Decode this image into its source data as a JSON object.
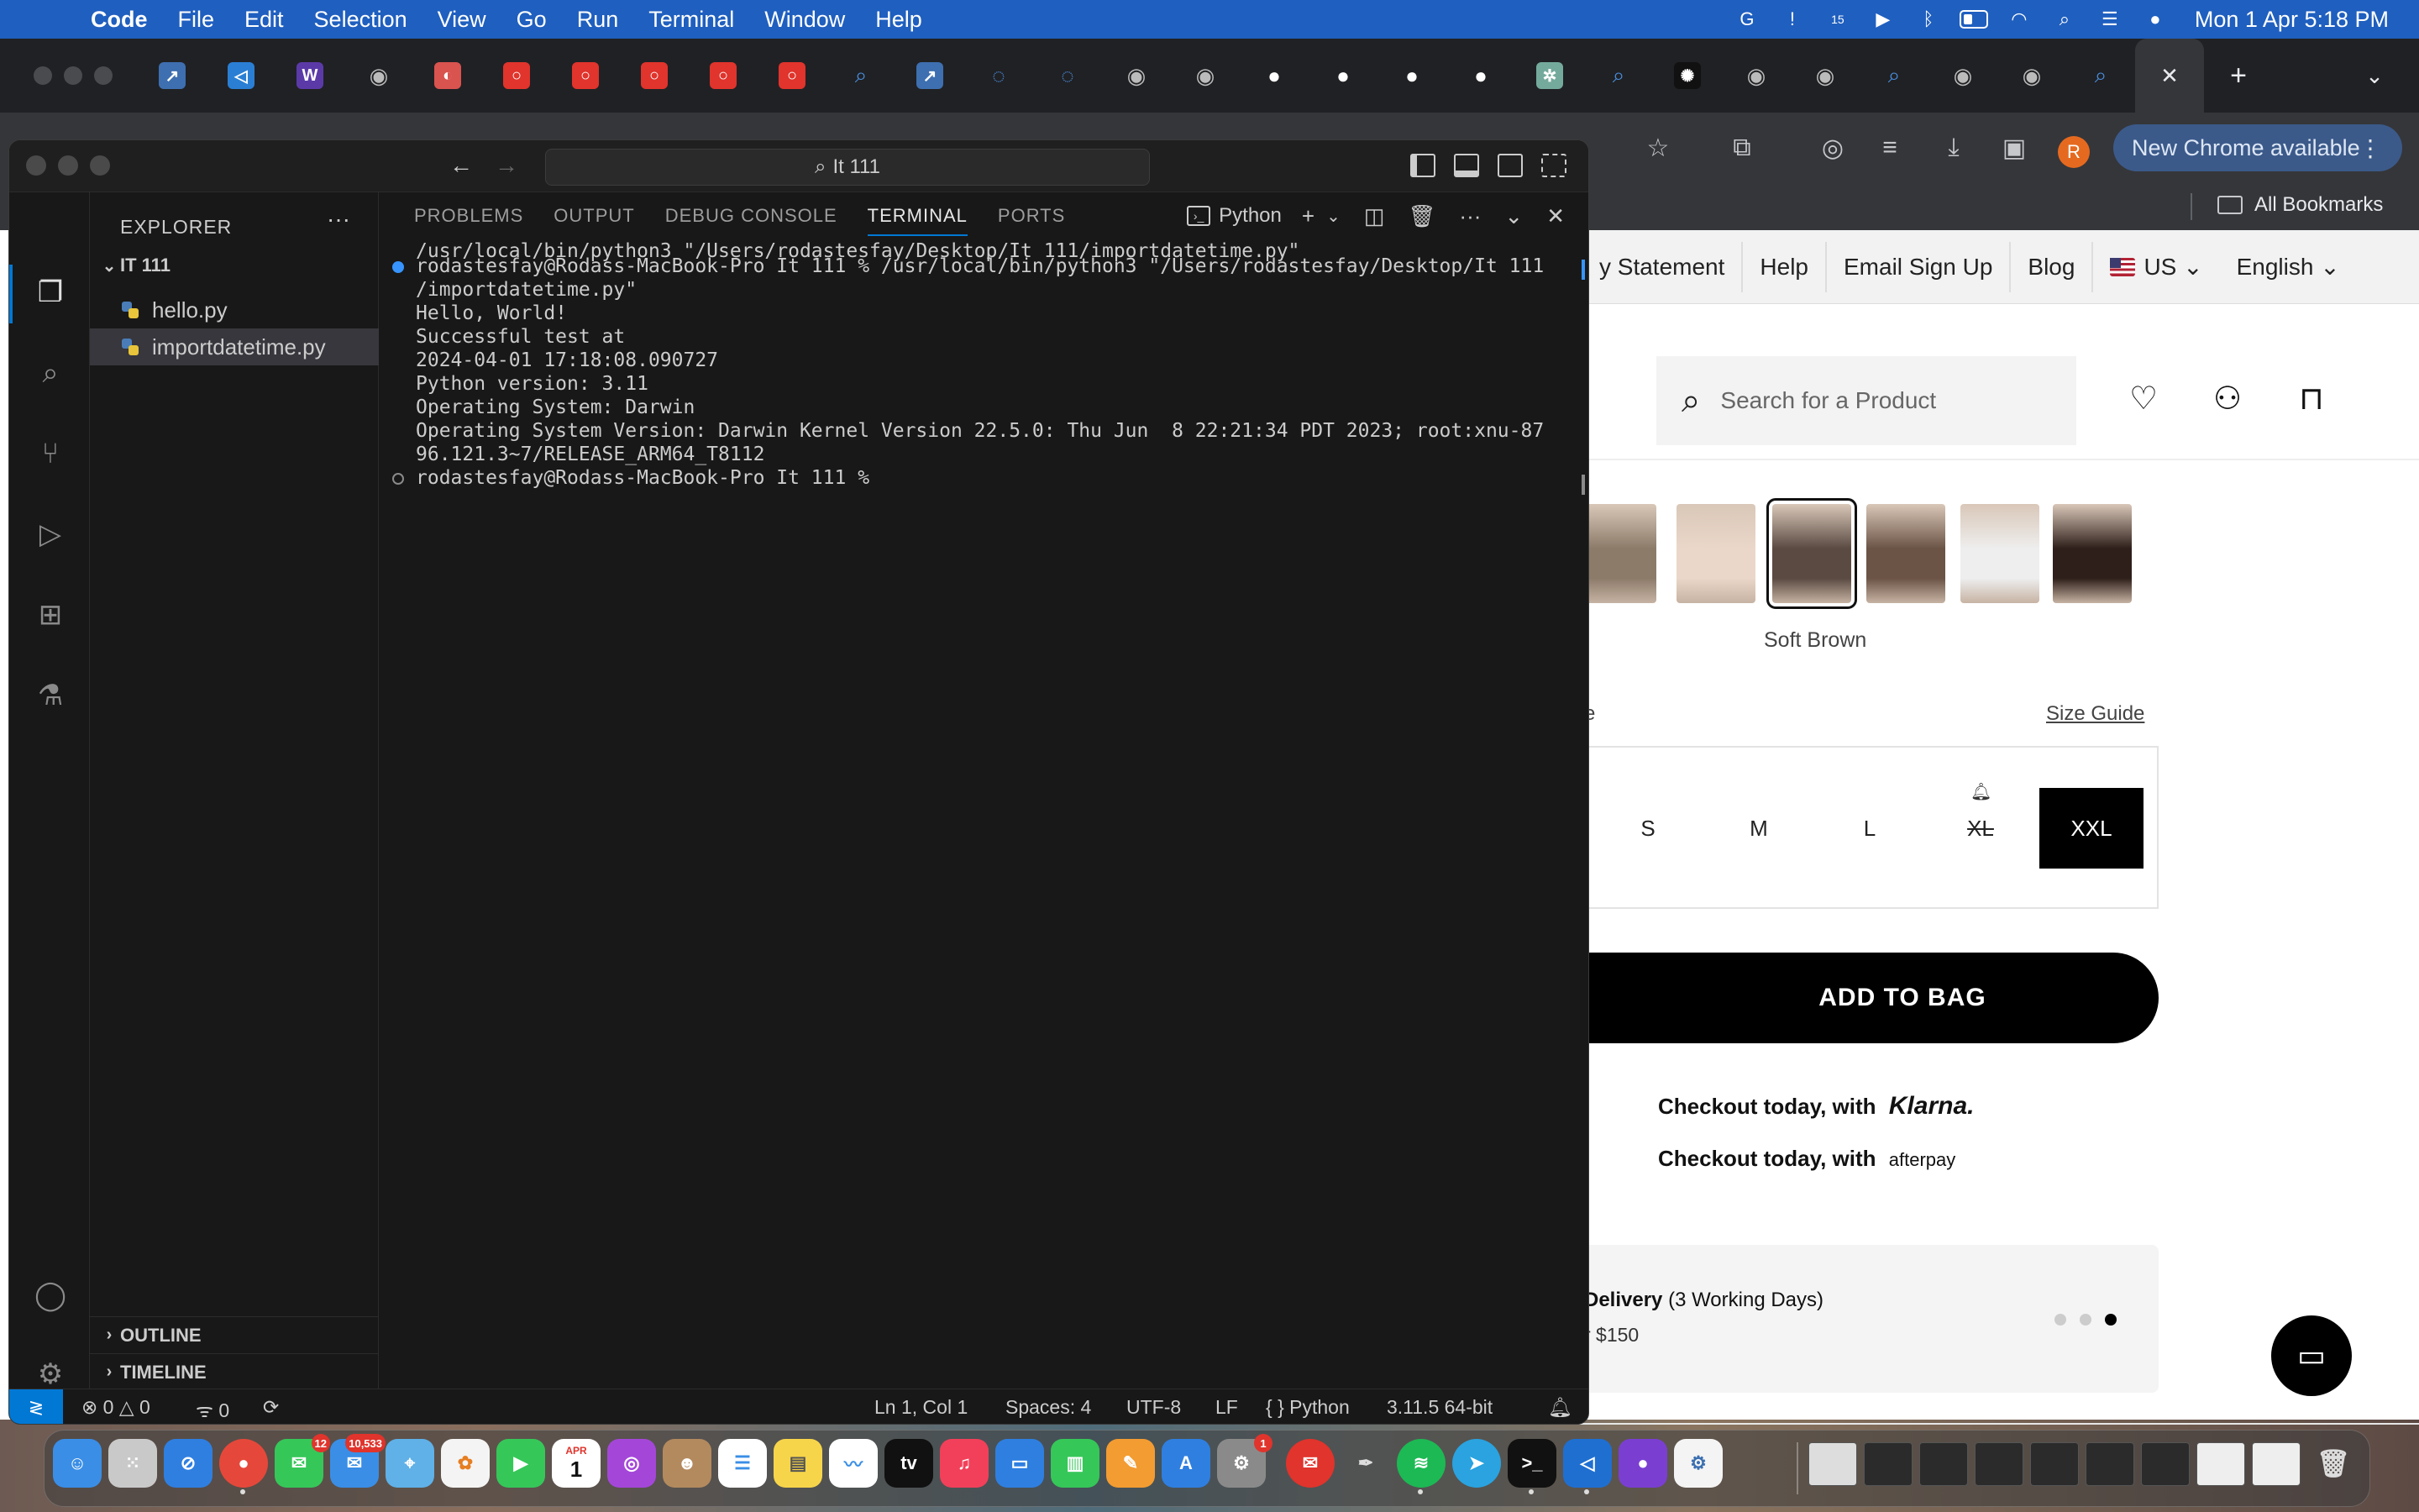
{
  "menubar": {
    "app_name": "Code",
    "items": [
      "File",
      "Edit",
      "Selection",
      "View",
      "Go",
      "Run",
      "Terminal",
      "Window",
      "Help"
    ],
    "clock": "Mon 1 Apr  5:18 PM",
    "notification_badge": "15"
  },
  "chrome": {
    "new_chrome_label": "New Chrome available",
    "bookmarks_label": "All Bookmarks",
    "avatar_initial": "R"
  },
  "site": {
    "nav_links": [
      "y Statement",
      "Help",
      "Email Sign Up",
      "Blog"
    ],
    "country": "US",
    "language": "English",
    "search_placeholder": "Search for a Product",
    "color_label": "Soft Brown",
    "size_label_fragment": "e",
    "size_guide": "Size Guide",
    "sizes": [
      "S",
      "M",
      "L",
      "XL",
      "XXL"
    ],
    "add_to_bag": "ADD TO BAG",
    "checkout_klarna_prefix": "Checkout today, with",
    "checkout_klarna_brand": "Klarna.",
    "checkout_afterpay_prefix": "Checkout today, with",
    "checkout_afterpay_brand": "afterpay",
    "delivery_title": "Delivery",
    "delivery_days": "(3 Working Days)",
    "delivery_sub": "r $150",
    "swatch_colors": [
      "#8d7b6a",
      "#ead7c9",
      "#5a4a42",
      "#6b5446",
      "#eeeeee",
      "#2e1f1a"
    ]
  },
  "vscode": {
    "search": "It 111",
    "explorer_title": "EXPLORER",
    "folder": "IT 111",
    "files": [
      "hello.py",
      "importdatetime.py"
    ],
    "sections": [
      "OUTLINE",
      "TIMELINE"
    ],
    "panel_tabs": [
      "PROBLEMS",
      "OUTPUT",
      "DEBUG CONSOLE",
      "TERMINAL",
      "PORTS"
    ],
    "terminal_profile": "Python",
    "terminal_lines": [
      "/usr/local/bin/python3 \"/Users/rodastesfay/Desktop/It 111/importdatetime.py\"",
      "rodastesfay@Rodass-MacBook-Pro It 111 % /usr/local/bin/python3 \"/Users/rodastesfay/Desktop/It 111",
      "/importdatetime.py\"",
      "Hello, World!",
      "Successful test at",
      "2024-04-01 17:18:08.090727",
      "Python version: 3.11",
      "Operating System: Darwin",
      "Operating System Version: Darwin Kernel Version 22.5.0: Thu Jun  8 22:21:34 PDT 2023; root:xnu-87",
      "96.121.3~7/RELEASE_ARM64_T8112",
      "rodastesfay@Rodass-MacBook-Pro It 111 %"
    ],
    "status": {
      "errors": "0",
      "warnings": "0",
      "ports": "0",
      "position": "Ln 1, Col 1",
      "spaces": "Spaces: 4",
      "encoding": "UTF-8",
      "eol": "LF",
      "language": "Python",
      "interpreter": "3.11.5 64-bit"
    }
  },
  "dock": {
    "messages_badge": "12",
    "mail_badge": "10,533",
    "calendar_month": "APR",
    "calendar_day": "1",
    "settings_badge": "1"
  }
}
